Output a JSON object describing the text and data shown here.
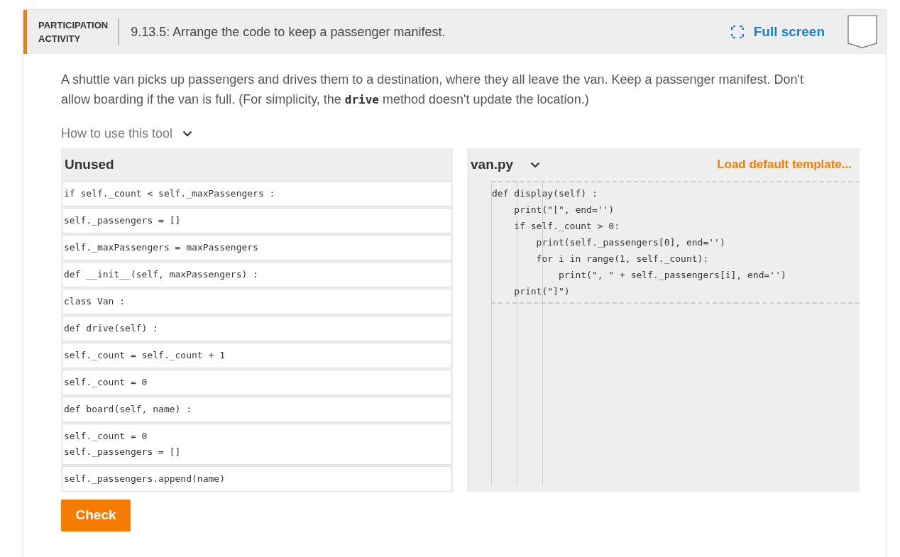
{
  "header": {
    "label_line1": "PARTICIPATION",
    "label_line2": "ACTIVITY",
    "title": "9.13.5: Arrange the code to keep a passenger manifest.",
    "fullscreen": "Full screen"
  },
  "description": [
    {
      "kind": "text",
      "text": "A shuttle van picks up passengers and drives them to a destination, where they all leave the van. Keep a passenger manifest. Don't allow boarding if the van is full. (For simplicity, the "
    },
    {
      "kind": "code",
      "text": "drive"
    },
    {
      "kind": "text",
      "text": " method doesn't update the location.)"
    }
  ],
  "help": {
    "label": "How to use this tool",
    "expanded": false
  },
  "unused": {
    "title": "Unused",
    "blocks": [
      {
        "lines": [
          "if self._count < self._maxPassengers :"
        ]
      },
      {
        "lines": [
          "self._passengers = []"
        ]
      },
      {
        "lines": [
          "self._maxPassengers = maxPassengers"
        ]
      },
      {
        "lines": [
          "def __init__(self, maxPassengers) :"
        ]
      },
      {
        "lines": [
          "class Van :"
        ]
      },
      {
        "lines": [
          "def drive(self) :"
        ]
      },
      {
        "lines": [
          "self._count = self._count + 1"
        ]
      },
      {
        "lines": [
          "self._count = 0"
        ]
      },
      {
        "lines": [
          "def board(self, name) :"
        ]
      },
      {
        "lines": [
          "self._count = 0",
          "self._passengers = []"
        ]
      },
      {
        "lines": [
          "self._passengers.append(name)"
        ]
      }
    ]
  },
  "editor": {
    "file": "van.py",
    "load_template": "Load default template...",
    "blocks": [
      {
        "lines": [
          "def display(self) :",
          "    print(\"[\", end='')",
          "    if self._count > 0:",
          "        print(self._passengers[0], end='')",
          "        for i in range(1, self._count):",
          "            print(\", \" + self._passengers[i], end='')",
          "    print(\"]\")"
        ]
      }
    ]
  },
  "check_button": "Check"
}
